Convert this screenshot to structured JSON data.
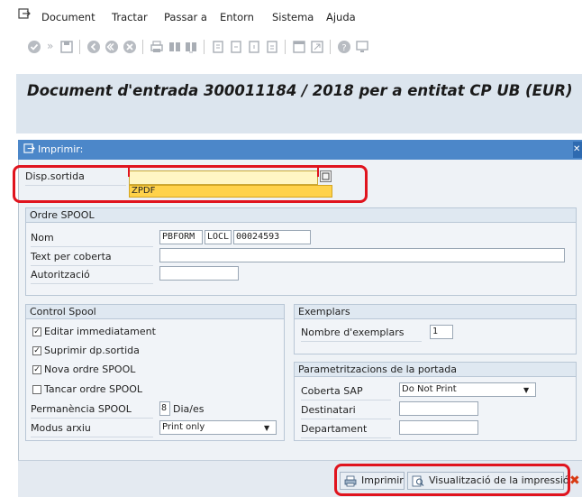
{
  "menu": {
    "items": [
      "Document",
      "Tractar",
      "Passar a",
      "Entorn",
      "Sistema",
      "Ajuda"
    ]
  },
  "title": "Document d'entrada 300011184 / 2018 per a entitat CP UB (EUR)",
  "dialog": {
    "title": "Imprimir:",
    "output_device_label": "Disp.sortida",
    "output_device_value": "",
    "suggestion": "ZPDF",
    "spool_request": {
      "header": "Ordre SPOOL",
      "name_label": "Nom",
      "name_parts": [
        "PBFORM",
        "LOCL",
        "00024593"
      ],
      "cover_text_label": "Text per coberta",
      "authorization_label": "Autorització"
    },
    "spool_control": {
      "header": "Control Spool",
      "options": [
        {
          "label": "Editar immediatament",
          "checked": true
        },
        {
          "label": "Suprimir dp.sortida",
          "checked": true
        },
        {
          "label": "Nova ordre SPOOL",
          "checked": true
        },
        {
          "label": "Tancar ordre SPOOL",
          "checked": false
        }
      ],
      "retention_label": "Permanència SPOOL",
      "retention_value": "8",
      "retention_unit": "Dia/es",
      "archive_mode_label": "Modus arxiu",
      "archive_mode_value": "Print only"
    },
    "copies": {
      "header": "Exemplars",
      "count_label": "Nombre d'exemplars",
      "count_value": "1"
    },
    "cover_settings": {
      "header": "Parametritzacions de la portada",
      "sap_cover_label": "Coberta SAP",
      "sap_cover_value": "Do Not Print",
      "recipient_label": "Destinatari",
      "department_label": "Departament"
    },
    "buttons": {
      "print": "Imprimir",
      "preview": "Visualització de la impressió"
    }
  },
  "colors": {
    "dialog_header": "#4c87c9",
    "highlight_box": "#e0141e",
    "suggestion_bg": "#ffd24a",
    "title_bar": "#dce5ee"
  }
}
